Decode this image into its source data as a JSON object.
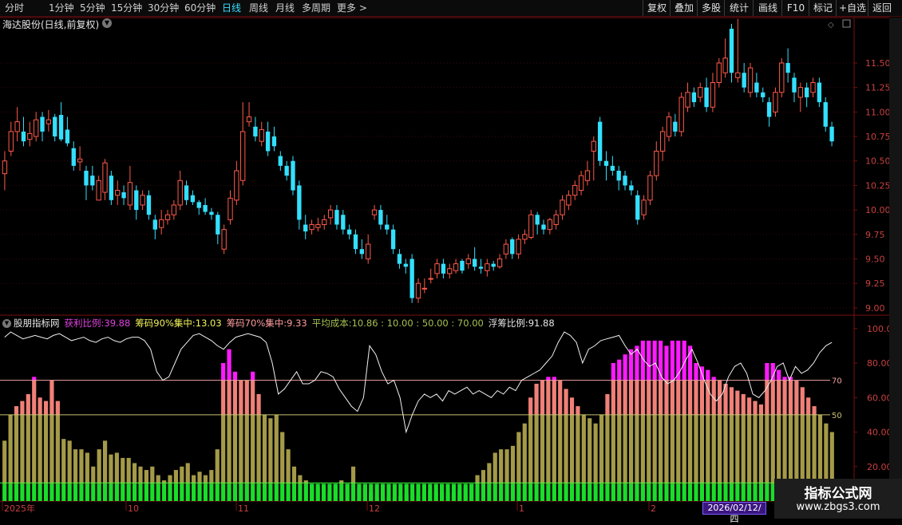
{
  "toolbar": {
    "periods": [
      "分时",
      "1分钟",
      "5分钟",
      "15分钟",
      "30分钟",
      "60分钟",
      "日线",
      "周线",
      "月线",
      "多周期",
      "更多 >"
    ],
    "active_period": "日线",
    "right_buttons": [
      "复权",
      "叠加",
      "多股",
      "统计",
      "画线",
      "F10",
      "标记",
      "+自选",
      "返回"
    ]
  },
  "stock": {
    "title": "海达股份(日线,前复权)"
  },
  "price_axis": [
    "11.50",
    "11.25",
    "11.00",
    "10.75",
    "10.50",
    "10.25",
    "10.00",
    "9.75",
    "9.50",
    "9.25",
    "9.00"
  ],
  "indicator": {
    "name": "股朋指标网",
    "items": [
      {
        "label": "获利比例:",
        "value": "39.88",
        "color": "#e040e0"
      },
      {
        "label": "筹码90%集中:",
        "value": "13.03",
        "color": "#f2f25a"
      },
      {
        "label": "筹码70%集中:",
        "value": "9.33",
        "color": "#ff9c9c"
      },
      {
        "label": "平均成本:",
        "value": "10.86 : 10.00 : 50.00 : 70.00",
        "color": "#a6c050"
      },
      {
        "label": "浮筹比例:",
        "value": "91.88",
        "color": "#e6e6e6"
      }
    ],
    "axis": [
      "100.0",
      "80.00",
      "60.00",
      "40.00",
      "20.00"
    ],
    "line_labels": [
      "70",
      "50"
    ]
  },
  "date_axis": [
    "2025年",
    "10",
    "11",
    "12",
    "1",
    "2"
  ],
  "cursor_date": "2026/02/12/四",
  "watermark": {
    "name": "指标公式网",
    "url": "www.zbgs3.com"
  },
  "colors": {
    "up": "#ff5a4a",
    "down": "#33e0ff",
    "profit_bar": "#ff1aff",
    "mid_bar": "#f08078",
    "low_bar": "#a49a48",
    "base_bar": "#1bdc2a"
  },
  "chart_data": {
    "type": "candlestick",
    "ylim": [
      8.95,
      11.85
    ],
    "candles": [
      [
        10.37,
        10.5,
        10.6,
        10.2
      ],
      [
        10.6,
        10.8,
        10.9,
        10.55
      ],
      [
        10.8,
        10.9,
        11.05,
        10.7
      ],
      [
        10.8,
        10.7,
        10.95,
        10.65
      ],
      [
        10.72,
        10.78,
        10.9,
        10.65
      ],
      [
        10.75,
        10.92,
        11.0,
        10.7
      ],
      [
        10.95,
        10.8,
        11.0,
        10.7
      ],
      [
        10.88,
        10.92,
        11.02,
        10.8
      ],
      [
        10.95,
        10.75,
        10.98,
        10.7
      ],
      [
        10.97,
        10.72,
        11.1,
        10.7
      ],
      [
        10.82,
        10.68,
        10.95,
        10.65
      ],
      [
        10.63,
        10.45,
        10.7,
        10.4
      ],
      [
        10.49,
        10.52,
        10.65,
        10.4
      ],
      [
        10.4,
        10.25,
        10.45,
        10.1
      ],
      [
        10.35,
        10.25,
        10.45,
        10.2
      ],
      [
        10.1,
        10.3,
        10.35,
        10.1
      ],
      [
        10.18,
        10.48,
        10.52,
        10.1
      ],
      [
        10.35,
        10.1,
        10.4,
        10.05
      ],
      [
        10.15,
        10.2,
        10.3,
        10.05
      ],
      [
        10.18,
        10.12,
        10.25,
        10.05
      ],
      [
        10.05,
        10.28,
        10.45,
        10.0
      ],
      [
        10.2,
        10.0,
        10.25,
        9.9
      ],
      [
        10.05,
        10.15,
        10.2,
        10.0
      ],
      [
        10.15,
        9.95,
        10.2,
        9.9
      ],
      [
        9.9,
        9.8,
        9.95,
        9.7
      ],
      [
        9.82,
        9.9,
        10.0,
        9.75
      ],
      [
        9.9,
        9.95,
        10.0,
        9.85
      ],
      [
        9.95,
        10.05,
        10.1,
        9.9
      ],
      [
        10.05,
        10.3,
        10.4,
        10.0
      ],
      [
        10.25,
        10.1,
        10.3,
        10.05
      ],
      [
        10.15,
        10.08,
        10.2,
        10.05
      ],
      [
        10.08,
        10.02,
        10.1,
        9.95
      ],
      [
        10.05,
        9.98,
        10.12,
        9.95
      ],
      [
        9.98,
        9.95,
        10.02,
        9.9
      ],
      [
        9.95,
        9.75,
        9.98,
        9.65
      ],
      [
        9.6,
        9.8,
        9.85,
        9.55
      ],
      [
        9.9,
        10.12,
        10.2,
        9.85
      ],
      [
        10.1,
        10.4,
        10.5,
        10.05
      ],
      [
        10.3,
        10.8,
        11.1,
        10.25
      ],
      [
        10.9,
        10.95,
        11.1,
        10.85
      ],
      [
        10.85,
        10.75,
        10.95,
        10.7
      ],
      [
        10.7,
        10.82,
        10.9,
        10.65
      ],
      [
        10.8,
        10.6,
        10.9,
        10.55
      ],
      [
        10.75,
        10.65,
        10.85,
        10.6
      ],
      [
        10.55,
        10.45,
        10.6,
        10.4
      ],
      [
        10.45,
        10.35,
        10.5,
        10.3
      ],
      [
        10.5,
        10.2,
        10.55,
        10.15
      ],
      [
        10.25,
        9.9,
        10.3,
        9.8
      ],
      [
        9.85,
        9.78,
        9.95,
        9.7
      ],
      [
        9.8,
        9.85,
        9.9,
        9.75
      ],
      [
        9.82,
        9.85,
        9.92,
        9.78
      ],
      [
        9.85,
        9.9,
        9.95,
        9.8
      ],
      [
        9.92,
        10.0,
        10.05,
        9.85
      ],
      [
        10.0,
        9.85,
        10.05,
        9.8
      ],
      [
        9.95,
        9.8,
        10.0,
        9.75
      ],
      [
        9.8,
        9.75,
        9.85,
        9.7
      ],
      [
        9.75,
        9.6,
        9.8,
        9.55
      ],
      [
        9.6,
        9.55,
        9.7,
        9.5
      ],
      [
        9.5,
        9.65,
        9.75,
        9.45
      ],
      [
        9.95,
        10.0,
        10.05,
        9.9
      ],
      [
        10.0,
        9.85,
        10.05,
        9.8
      ],
      [
        9.85,
        9.8,
        9.95,
        9.75
      ],
      [
        9.8,
        9.6,
        9.85,
        9.55
      ],
      [
        9.55,
        9.45,
        9.6,
        9.4
      ],
      [
        9.45,
        9.42,
        9.5,
        9.35
      ],
      [
        9.5,
        9.1,
        9.55,
        9.05
      ],
      [
        9.1,
        9.25,
        9.3,
        9.05
      ],
      [
        9.2,
        9.2,
        9.3,
        9.15
      ],
      [
        9.3,
        9.3,
        9.4,
        9.25
      ],
      [
        9.35,
        9.45,
        9.5,
        9.3
      ],
      [
        9.45,
        9.35,
        9.5,
        9.3
      ],
      [
        9.35,
        9.4,
        9.45,
        9.3
      ],
      [
        9.38,
        9.45,
        9.5,
        9.35
      ],
      [
        9.48,
        9.38,
        9.5,
        9.35
      ],
      [
        9.45,
        9.5,
        9.55,
        9.4
      ],
      [
        9.5,
        9.42,
        9.62,
        9.38
      ],
      [
        9.42,
        9.4,
        9.5,
        9.35
      ],
      [
        9.38,
        9.45,
        9.5,
        9.32
      ],
      [
        9.45,
        9.42,
        9.48,
        9.38
      ],
      [
        9.42,
        9.5,
        9.55,
        9.4
      ],
      [
        9.55,
        9.65,
        9.7,
        9.5
      ],
      [
        9.7,
        9.55,
        9.72,
        9.5
      ],
      [
        9.55,
        9.7,
        9.75,
        9.5
      ],
      [
        9.7,
        9.75,
        9.8,
        9.65
      ],
      [
        9.72,
        9.95,
        10.0,
        9.7
      ],
      [
        9.95,
        9.85,
        9.98,
        9.75
      ],
      [
        9.85,
        9.8,
        9.9,
        9.75
      ],
      [
        9.8,
        9.9,
        9.92,
        9.75
      ],
      [
        9.85,
        9.95,
        10.0,
        9.8
      ],
      [
        9.95,
        10.1,
        10.15,
        9.9
      ],
      [
        10.05,
        10.15,
        10.2,
        10.0
      ],
      [
        10.15,
        10.25,
        10.3,
        10.1
      ],
      [
        10.2,
        10.35,
        10.4,
        10.15
      ],
      [
        10.3,
        10.4,
        10.5,
        10.25
      ],
      [
        10.6,
        10.7,
        10.75,
        10.3
      ],
      [
        10.9,
        10.5,
        10.95,
        10.45
      ],
      [
        10.5,
        10.45,
        10.6,
        10.3
      ],
      [
        10.45,
        10.4,
        10.55,
        10.35
      ],
      [
        10.4,
        10.3,
        10.45,
        10.2
      ],
      [
        10.35,
        10.25,
        10.4,
        10.2
      ],
      [
        10.25,
        10.2,
        10.3,
        10.15
      ],
      [
        10.15,
        9.9,
        10.2,
        9.85
      ],
      [
        9.95,
        10.1,
        10.15,
        9.9
      ],
      [
        10.1,
        10.35,
        10.4,
        10.05
      ],
      [
        10.35,
        10.6,
        10.7,
        10.3
      ],
      [
        10.6,
        10.8,
        10.85,
        10.5
      ],
      [
        10.75,
        10.95,
        11.0,
        10.7
      ],
      [
        10.9,
        10.8,
        10.98,
        10.75
      ],
      [
        10.8,
        11.15,
        11.2,
        10.75
      ],
      [
        11.05,
        11.2,
        11.3,
        11.0
      ],
      [
        11.2,
        11.1,
        11.25,
        11.05
      ],
      [
        11.15,
        11.25,
        11.3,
        11.1
      ],
      [
        11.25,
        11.05,
        11.35,
        11.0
      ],
      [
        11.05,
        11.3,
        11.4,
        11.0
      ],
      [
        11.3,
        11.5,
        11.55,
        11.25
      ],
      [
        11.4,
        11.55,
        11.75,
        11.35
      ],
      [
        11.85,
        11.4,
        11.9,
        11.3
      ],
      [
        11.35,
        11.4,
        11.95,
        11.3
      ],
      [
        11.4,
        11.25,
        11.5,
        11.2
      ],
      [
        11.2,
        11.45,
        11.5,
        11.15
      ],
      [
        11.3,
        11.2,
        11.4,
        11.15
      ],
      [
        11.2,
        11.15,
        11.25,
        11.1
      ],
      [
        11.1,
        10.95,
        11.15,
        10.85
      ],
      [
        11.0,
        11.2,
        11.25,
        10.95
      ],
      [
        11.2,
        11.5,
        11.55,
        11.15
      ],
      [
        11.5,
        11.4,
        11.65,
        11.3
      ],
      [
        11.35,
        11.2,
        11.4,
        11.1
      ],
      [
        11.15,
        11.25,
        11.3,
        11.0
      ],
      [
        11.25,
        11.15,
        11.3,
        11.05
      ],
      [
        11.2,
        11.3,
        11.35,
        11.15
      ],
      [
        11.3,
        11.1,
        11.35,
        11.05
      ],
      [
        11.1,
        10.85,
        11.15,
        10.8
      ],
      [
        10.85,
        10.7,
        10.9,
        10.65
      ]
    ],
    "profit_bars": [
      35,
      50,
      55,
      58,
      62,
      72,
      60,
      58,
      70,
      58,
      36,
      35,
      30,
      30,
      28,
      20,
      30,
      35,
      27,
      28,
      25,
      25,
      22,
      20,
      18,
      20,
      15,
      12,
      15,
      18,
      20,
      22,
      15,
      17,
      15,
      18,
      30,
      80,
      88,
      75,
      70,
      70,
      75,
      62,
      50,
      48,
      50,
      40,
      30,
      20,
      15,
      12,
      10,
      8,
      8,
      5,
      10,
      12,
      10,
      20,
      8,
      8,
      5,
      2,
      2,
      2,
      2,
      3,
      4,
      4,
      3,
      5,
      6,
      5,
      5,
      5,
      5,
      6,
      8,
      10,
      15,
      18,
      22,
      28,
      30,
      30,
      32,
      40,
      45,
      60,
      68,
      70,
      72,
      72,
      70,
      65,
      60,
      55,
      50,
      48,
      45,
      50,
      62,
      80,
      82,
      85,
      88,
      90,
      93,
      93,
      93,
      93,
      90,
      93,
      93,
      93,
      90,
      80,
      78,
      76,
      72,
      70,
      68,
      66,
      64,
      62,
      60,
      58,
      56,
      80,
      80,
      76,
      72,
      72,
      70,
      66,
      60,
      55,
      50,
      45,
      40
    ],
    "float_line": [
      95,
      98,
      96,
      94,
      95,
      96,
      95,
      94,
      96,
      97,
      95,
      93,
      94,
      95,
      93,
      92,
      94,
      95,
      93,
      92,
      94,
      95,
      95,
      93,
      88,
      75,
      70,
      72,
      80,
      88,
      92,
      96,
      97,
      95,
      93,
      90,
      88,
      92,
      95,
      96,
      97,
      96,
      95,
      92,
      80,
      62,
      65,
      70,
      75,
      68,
      68,
      70,
      75,
      74,
      72,
      65,
      60,
      55,
      52,
      60,
      90,
      85,
      75,
      68,
      70,
      60,
      40,
      50,
      58,
      62,
      60,
      62,
      58,
      64,
      62,
      64,
      66,
      62,
      64,
      62,
      60,
      64,
      62,
      66,
      64,
      70,
      72,
      74,
      76,
      80,
      84,
      92,
      98,
      96,
      92,
      80,
      88,
      90,
      93,
      94,
      95,
      96,
      90,
      85,
      88,
      82,
      78,
      80,
      72,
      68,
      70,
      75,
      82,
      88,
      80,
      70,
      62,
      58,
      62,
      72,
      78,
      80,
      74,
      62,
      60,
      64,
      70,
      78,
      80,
      70,
      78,
      74,
      76,
      80,
      86,
      90,
      92
    ]
  }
}
